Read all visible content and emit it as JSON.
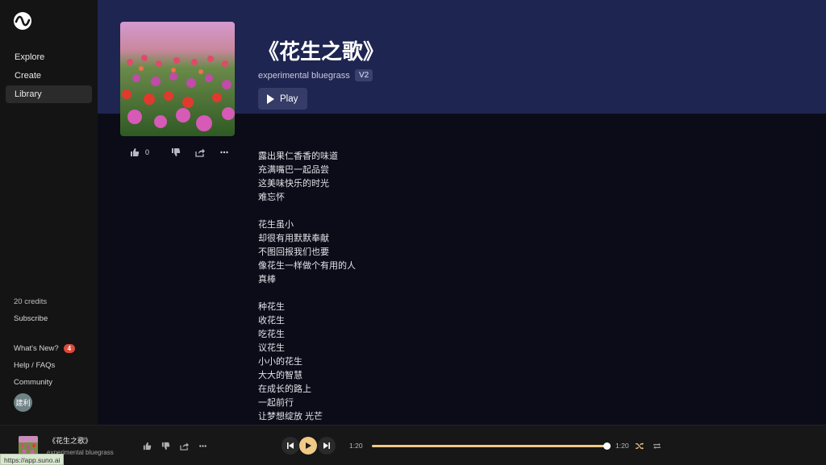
{
  "sidebar": {
    "nav": [
      {
        "label": "Explore"
      },
      {
        "label": "Create"
      },
      {
        "label": "Library"
      }
    ],
    "credits": "20 credits",
    "subscribe": "Subscribe",
    "whats_new": "What's New?",
    "whats_new_badge": "4",
    "help": "Help / FAQs",
    "community": "Community",
    "avatar_text": "建利"
  },
  "song": {
    "title": "《花生之歌》",
    "style": "experimental bluegrass",
    "version": "V2",
    "play_label": "Play",
    "like_count": "0",
    "lyrics": [
      "露出果仁香香的味道",
      "充满嘴巴一起品尝",
      "这美味快乐的时光",
      "难忘怀",
      "",
      "花生虽小",
      "却很有用默默奉献",
      "不图回报我们也要",
      "像花生一样做个有用的人",
      "真棒",
      "",
      "种花生",
      "收花生",
      "吃花生",
      "议花生",
      "小小的花生",
      "大大的智慧",
      "在成长的路上",
      "一起前行",
      "让梦想绽放 光芒"
    ]
  },
  "player": {
    "title": "《花生之歌》",
    "style": "experimental bluegrass",
    "elapsed": "1:20",
    "duration": "1:20",
    "progress": 1.0,
    "accent": "#f0c987"
  },
  "status_url": "https://app.suno.ai"
}
